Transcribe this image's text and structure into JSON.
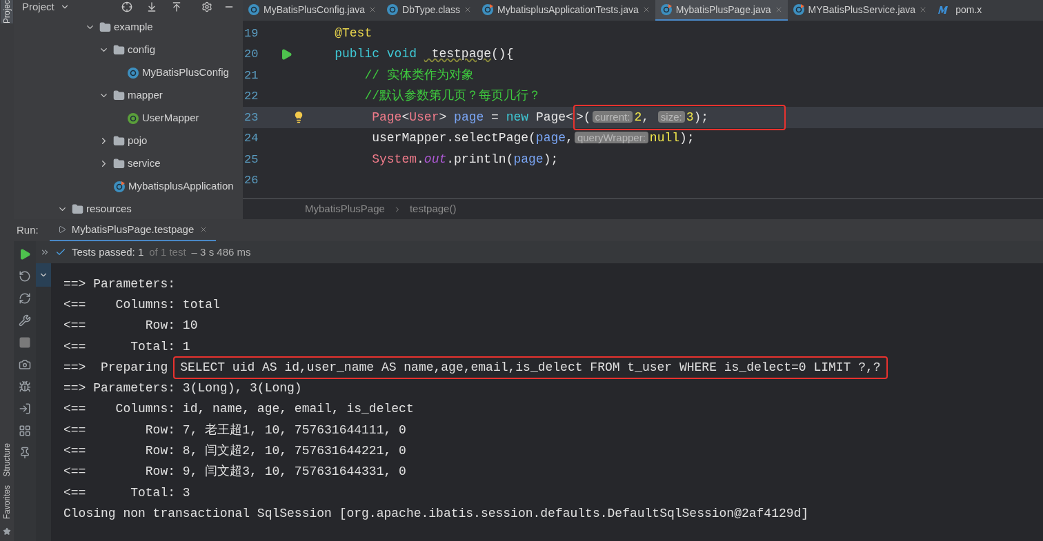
{
  "side_tabs": {
    "top": "Projec",
    "bottom": [
      "Structure",
      "Favorites"
    ]
  },
  "project_panel": {
    "title": "Project",
    "tree": [
      {
        "label": "example",
        "kind": "folder",
        "expanded": true,
        "children": [
          {
            "label": "config",
            "kind": "folder",
            "expanded": true,
            "children": [
              {
                "label": "MyBatisPlusConfig",
                "kind": "class"
              }
            ]
          },
          {
            "label": "mapper",
            "kind": "folder",
            "expanded": true,
            "children": [
              {
                "label": "UserMapper",
                "kind": "interface"
              }
            ]
          },
          {
            "label": "pojo",
            "kind": "folder",
            "expanded": false
          },
          {
            "label": "service",
            "kind": "folder",
            "expanded": false
          },
          {
            "label": "MybatisplusApplication",
            "kind": "app"
          }
        ]
      }
    ],
    "tree_tail": [
      {
        "label": "resources",
        "kind": "resources",
        "expanded": true
      }
    ]
  },
  "editor_tabs": [
    {
      "label": "MyBatisPlusConfig.java",
      "kind": "class",
      "selected": false
    },
    {
      "label": "DbType.class",
      "kind": "enum",
      "selected": false
    },
    {
      "label": "MybatisplusApplicationTests.java",
      "kind": "test",
      "selected": false
    },
    {
      "label": "MybatisPlusPage.java",
      "kind": "test",
      "selected": true
    },
    {
      "label": "MYBatisPlusService.java",
      "kind": "test",
      "selected": false
    },
    {
      "label": "pom.x",
      "kind": "maven",
      "selected": false
    }
  ],
  "code_lines": [
    {
      "number": "19",
      "current": false,
      "run_marker": false,
      "bulb": false,
      "tokens": [
        {
          "text": "    @Test",
          "kind": "annotation"
        }
      ]
    },
    {
      "number": "20",
      "current": false,
      "run_marker": true,
      "bulb": false,
      "tokens": [
        {
          "text": "    public void ",
          "kind": "keyword"
        },
        {
          "text": " testpage",
          "kind": "method"
        },
        {
          "text": "(){",
          "kind": "plain"
        }
      ]
    },
    {
      "number": "21",
      "current": false,
      "run_marker": false,
      "bulb": false,
      "tokens": [
        {
          "text": "        // 实体类作为对象",
          "kind": "comment"
        }
      ]
    },
    {
      "number": "22",
      "current": false,
      "run_marker": false,
      "bulb": false,
      "tokens": [
        {
          "text": "        //默认参数第几页？每页几行？",
          "kind": "comment"
        }
      ]
    },
    {
      "number": "23",
      "current": true,
      "run_marker": false,
      "bulb": true,
      "tokens": [
        {
          "text": "         Page",
          "kind": "type"
        },
        {
          "text": "<",
          "kind": "plain"
        },
        {
          "text": "User",
          "kind": "type"
        },
        {
          "text": "> ",
          "kind": "plain"
        },
        {
          "text": "page",
          "kind": "variable"
        },
        {
          "text": " = ",
          "kind": "plain"
        },
        {
          "text": "new",
          "kind": "keyword"
        },
        {
          "text": " Page<",
          "kind": "plain"
        }
      ],
      "boxed": [
        {
          "text": ">(",
          "kind": "plain"
        },
        {
          "text": "current:",
          "kind": "hint"
        },
        {
          "text": "2",
          "kind": "number"
        },
        {
          "text": ", ",
          "kind": "plain"
        },
        {
          "text": "size:",
          "kind": "hint"
        },
        {
          "text": "3",
          "kind": "number"
        },
        {
          "text": ");",
          "kind": "plain"
        }
      ]
    },
    {
      "number": "24",
      "current": false,
      "run_marker": false,
      "bulb": false,
      "tokens": [
        {
          "text": "         userMapper.selectPage(",
          "kind": "plain"
        },
        {
          "text": "page",
          "kind": "variable"
        },
        {
          "text": ",",
          "kind": "plain"
        },
        {
          "text": "queryWrapper:",
          "kind": "hint"
        },
        {
          "text": "null",
          "kind": "number"
        },
        {
          "text": ");",
          "kind": "plain"
        }
      ]
    },
    {
      "number": "25",
      "current": false,
      "run_marker": false,
      "bulb": false,
      "tokens": [
        {
          "text": "         System",
          "kind": "type"
        },
        {
          "text": ".",
          "kind": "plain"
        },
        {
          "text": "out",
          "kind": "static"
        },
        {
          "text": ".println(",
          "kind": "plain"
        },
        {
          "text": "page",
          "kind": "variable"
        },
        {
          "text": ");",
          "kind": "plain"
        }
      ]
    },
    {
      "number": "26",
      "current": false,
      "run_marker": false,
      "bulb": false
    }
  ],
  "breadcrumb": [
    "MybatisPlusPage",
    "testpage()"
  ],
  "run": {
    "label": "Run:",
    "tab": "MybatisPlusPage.testpage",
    "status": "Tests passed: 1",
    "status_detail": "of 1 test",
    "duration": "– 3 s 486 ms"
  },
  "console_lines": [
    {
      "text": "==> Parameters: "
    },
    {
      "text": "<==    Columns: total"
    },
    {
      "text": "<==        Row: 10"
    },
    {
      "text": "<==      Total: 1"
    },
    {
      "text": "==>  Preparing",
      "highlight": "SELECT uid AS id,user_name AS name,age,email,is_delect FROM t_user WHERE is_delect=0 LIMIT ?,?"
    },
    {
      "text": "==> Parameters: 3(Long), 3(Long)"
    },
    {
      "text": "<==    Columns: id, name, age, email, is_delect"
    },
    {
      "text": "<==        Row: 7, 老王超1, 10, 757631644111, 0"
    },
    {
      "text": "<==        Row: 8, 闫文超2, 10, 757631644221, 0"
    },
    {
      "text": "<==        Row: 9, 闫文超3, 10, 757631644331, 0"
    },
    {
      "text": "<==      Total: 3"
    },
    {
      "text": "Closing non transactional SqlSession [org.apache.ibatis.session.defaults.DefaultSqlSession@2af4129d]"
    }
  ]
}
